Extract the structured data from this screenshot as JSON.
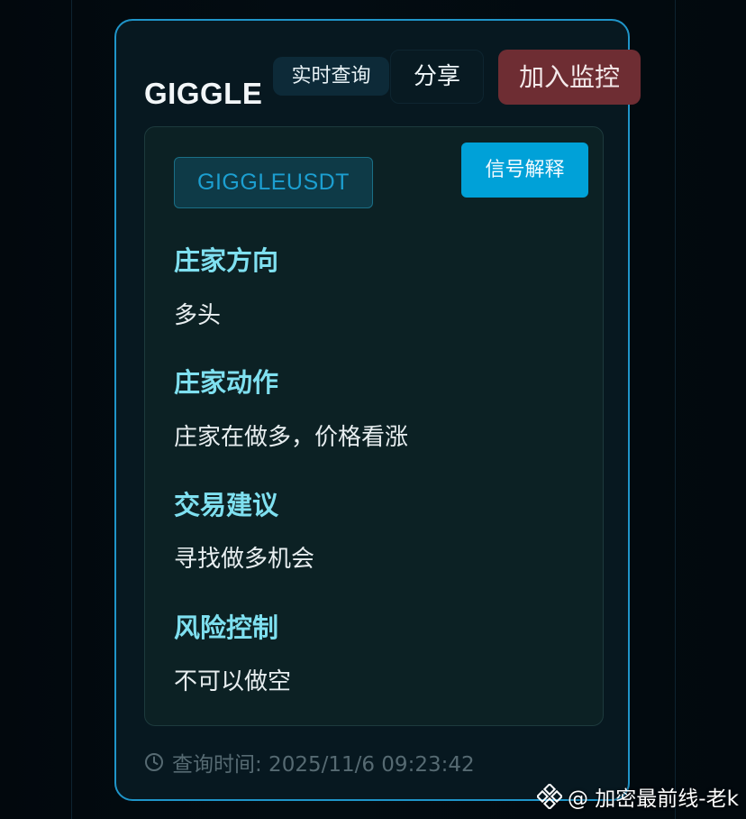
{
  "header": {
    "symbol": "GIGGLE",
    "realtime_label": "实时查询",
    "share_label": "分享",
    "monitor_label": "加入监控"
  },
  "panel": {
    "pair": "GIGGLEUSDT",
    "explain_label": "信号解释",
    "sections": [
      {
        "title": "庄家方向",
        "value": "多头"
      },
      {
        "title": "庄家动作",
        "value": "庄家在做多，价格看涨"
      },
      {
        "title": "交易建议",
        "value": "寻找做多机会"
      },
      {
        "title": "风险控制",
        "value": "不可以做空"
      }
    ]
  },
  "footer": {
    "query_time": "查询时间: 2025/11/6 09:23:42"
  },
  "watermark": {
    "text": "@ 加密最前线-老k"
  },
  "colors": {
    "accent_border": "#1f95c9",
    "section_title": "#7fe0f0",
    "explain_button": "#00a1d8",
    "monitor_button": "#6e2d33"
  },
  "icons": {
    "clock": "clock-icon",
    "binance": "binance-logo-icon"
  }
}
